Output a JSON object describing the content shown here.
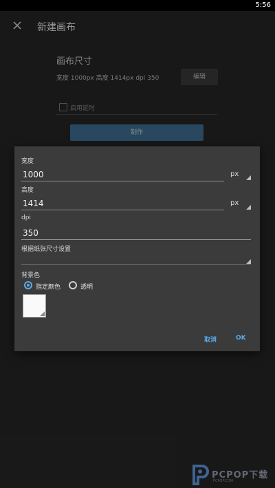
{
  "status_bar": {
    "time": "5:56"
  },
  "app_bar": {
    "title": "新建画布",
    "close_icon": "close-icon"
  },
  "background": {
    "section_title": "画布尺寸",
    "dimensions_text": "宽度 1000px 高度 1414px dpi 350",
    "edit_label": "编辑",
    "checkbox_label": "启用延时",
    "make_label": "制作",
    "make_color": "#3f6f93"
  },
  "dialog": {
    "width_label": "宽度",
    "width_value": "1000",
    "width_unit": "px",
    "height_label": "高度",
    "height_value": "1414",
    "height_unit": "px",
    "dpi_label": "dpi",
    "dpi_value": "350",
    "paper_label": "根据纸张尺寸设置",
    "bg_color_label": "背景色",
    "radio_specify": "指定颜色",
    "radio_transparent": "透明",
    "selected_option": "指定颜色",
    "swatch_color": "#fafafa",
    "cancel_label": "取消",
    "ok_label": "OK",
    "accent_color": "#5aa9e6"
  },
  "watermark": {
    "text": "PCPOP下载",
    "sub": "PCPOP.COM"
  }
}
